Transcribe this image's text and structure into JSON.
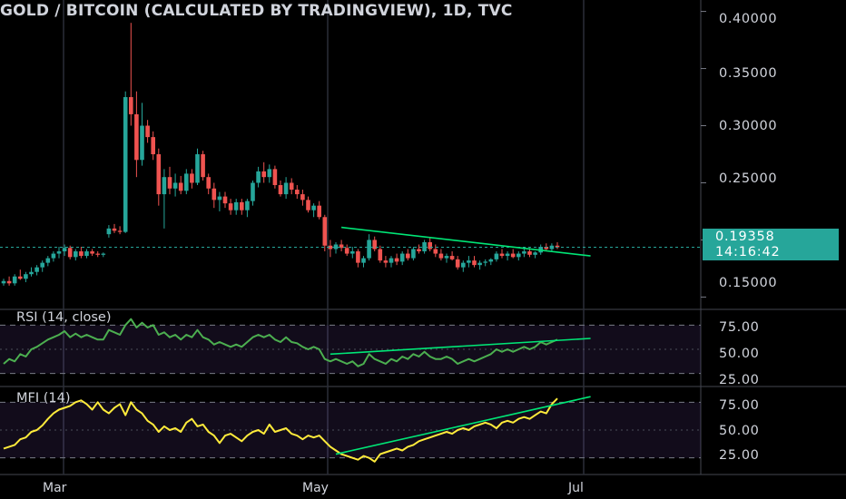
{
  "header": {
    "title": "GOLD / BITCOIN (CALCULATED BY TRADINGVIEW), 1D, TVC"
  },
  "colors": {
    "up": "#26a69a",
    "down": "#ef5350",
    "rsi": "#4caf50",
    "mfi": "#ffeb3b",
    "trend": "#00e676",
    "grid": "#2a2e39"
  },
  "price_pane": {
    "ticks": [
      "0.40000",
      "0.35000",
      "0.30000",
      "0.25000",
      "0.15000"
    ],
    "last_price": "0.19358",
    "countdown": "14:16:42"
  },
  "rsi_pane": {
    "label": "RSI (14, close)",
    "ticks": [
      "75.00",
      "50.00",
      "25.00"
    ]
  },
  "mfi_pane": {
    "label": "MFI (14)",
    "ticks": [
      "75.00",
      "50.00",
      "25.00"
    ]
  },
  "x_axis": {
    "labels": [
      "Mar",
      "May",
      "Jul"
    ]
  },
  "chart_data": [
    {
      "type": "candlestick",
      "series_name": "GOLD / BITCOIN",
      "ylim": [
        0.14,
        0.41
      ],
      "x_labels": [
        "Mar",
        "May",
        "Jul"
      ],
      "candles": [
        [
          0.162,
          0.166,
          0.16,
          0.164
        ],
        [
          0.164,
          0.168,
          0.16,
          0.162
        ],
        [
          0.162,
          0.17,
          0.16,
          0.168
        ],
        [
          0.168,
          0.174,
          0.165,
          0.166
        ],
        [
          0.166,
          0.172,
          0.163,
          0.17
        ],
        [
          0.17,
          0.176,
          0.168,
          0.172
        ],
        [
          0.172,
          0.178,
          0.169,
          0.176
        ],
        [
          0.176,
          0.182,
          0.172,
          0.18
        ],
        [
          0.18,
          0.186,
          0.177,
          0.184
        ],
        [
          0.184,
          0.19,
          0.181,
          0.188
        ],
        [
          0.188,
          0.194,
          0.184,
          0.19
        ],
        [
          0.19,
          0.196,
          0.186,
          0.193
        ],
        [
          0.193,
          0.195,
          0.183,
          0.185
        ],
        [
          0.185,
          0.192,
          0.182,
          0.19
        ],
        [
          0.19,
          0.194,
          0.184,
          0.186
        ],
        [
          0.186,
          0.192,
          0.184,
          0.19
        ],
        [
          0.19,
          0.192,
          0.186,
          0.188
        ],
        [
          0.188,
          0.19,
          0.185,
          0.187
        ],
        [
          0.187,
          0.189,
          0.185,
          0.188
        ],
        [
          0.205,
          0.213,
          0.202,
          0.21
        ],
        [
          0.21,
          0.214,
          0.206,
          0.208
        ],
        [
          0.208,
          0.212,
          0.205,
          0.207
        ],
        [
          0.207,
          0.33,
          0.206,
          0.325
        ],
        [
          0.325,
          0.39,
          0.3,
          0.31
        ],
        [
          0.31,
          0.33,
          0.255,
          0.27
        ],
        [
          0.27,
          0.32,
          0.265,
          0.3
        ],
        [
          0.3,
          0.305,
          0.285,
          0.29
        ],
        [
          0.29,
          0.295,
          0.27,
          0.275
        ],
        [
          0.275,
          0.28,
          0.23,
          0.24
        ],
        [
          0.24,
          0.262,
          0.21,
          0.255
        ],
        [
          0.255,
          0.264,
          0.24,
          0.245
        ],
        [
          0.245,
          0.258,
          0.238,
          0.25
        ],
        [
          0.25,
          0.256,
          0.24,
          0.243
        ],
        [
          0.243,
          0.262,
          0.24,
          0.258
        ],
        [
          0.258,
          0.262,
          0.245,
          0.25
        ],
        [
          0.25,
          0.28,
          0.248,
          0.275
        ],
        [
          0.275,
          0.278,
          0.252,
          0.255
        ],
        [
          0.255,
          0.258,
          0.24,
          0.245
        ],
        [
          0.245,
          0.25,
          0.228,
          0.235
        ],
        [
          0.235,
          0.242,
          0.225,
          0.238
        ],
        [
          0.238,
          0.242,
          0.228,
          0.232
        ],
        [
          0.232,
          0.236,
          0.222,
          0.226
        ],
        [
          0.226,
          0.236,
          0.222,
          0.233
        ],
        [
          0.233,
          0.236,
          0.222,
          0.226
        ],
        [
          0.226,
          0.236,
          0.22,
          0.234
        ],
        [
          0.234,
          0.252,
          0.23,
          0.25
        ],
        [
          0.25,
          0.264,
          0.246,
          0.26
        ],
        [
          0.26,
          0.268,
          0.25,
          0.255
        ],
        [
          0.255,
          0.266,
          0.25,
          0.262
        ],
        [
          0.262,
          0.265,
          0.245,
          0.248
        ],
        [
          0.248,
          0.252,
          0.238,
          0.24
        ],
        [
          0.24,
          0.255,
          0.236,
          0.25
        ],
        [
          0.25,
          0.254,
          0.24,
          0.244
        ],
        [
          0.244,
          0.248,
          0.236,
          0.24
        ],
        [
          0.24,
          0.244,
          0.23,
          0.235
        ],
        [
          0.235,
          0.238,
          0.224,
          0.226
        ],
        [
          0.226,
          0.232,
          0.22,
          0.23
        ],
        [
          0.23,
          0.234,
          0.218,
          0.22
        ],
        [
          0.22,
          0.222,
          0.19,
          0.195
        ],
        [
          0.195,
          0.2,
          0.185,
          0.192
        ],
        [
          0.192,
          0.198,
          0.188,
          0.196
        ],
        [
          0.196,
          0.2,
          0.19,
          0.193
        ],
        [
          0.193,
          0.196,
          0.186,
          0.188
        ],
        [
          0.188,
          0.194,
          0.184,
          0.19
        ],
        [
          0.19,
          0.192,
          0.176,
          0.18
        ],
        [
          0.18,
          0.186,
          0.176,
          0.184
        ],
        [
          0.184,
          0.205,
          0.182,
          0.2
        ],
        [
          0.2,
          0.203,
          0.19,
          0.192
        ],
        [
          0.192,
          0.195,
          0.18,
          0.182
        ],
        [
          0.182,
          0.186,
          0.176,
          0.18
        ],
        [
          0.18,
          0.186,
          0.176,
          0.184
        ],
        [
          0.184,
          0.188,
          0.178,
          0.181
        ],
        [
          0.181,
          0.19,
          0.178,
          0.188
        ],
        [
          0.188,
          0.192,
          0.182,
          0.184
        ],
        [
          0.184,
          0.194,
          0.182,
          0.192
        ],
        [
          0.192,
          0.196,
          0.188,
          0.19
        ],
        [
          0.19,
          0.2,
          0.188,
          0.198
        ],
        [
          0.198,
          0.202,
          0.19,
          0.192
        ],
        [
          0.192,
          0.196,
          0.185,
          0.188
        ],
        [
          0.188,
          0.192,
          0.182,
          0.184
        ],
        [
          0.184,
          0.188,
          0.18,
          0.186
        ],
        [
          0.186,
          0.19,
          0.182,
          0.183
        ],
        [
          0.183,
          0.186,
          0.174,
          0.176
        ],
        [
          0.176,
          0.182,
          0.172,
          0.18
        ],
        [
          0.18,
          0.186,
          0.176,
          0.182
        ],
        [
          0.182,
          0.186,
          0.176,
          0.178
        ],
        [
          0.178,
          0.182,
          0.174,
          0.18
        ],
        [
          0.18,
          0.183,
          0.177,
          0.181
        ],
        [
          0.181,
          0.184,
          0.178,
          0.183
        ],
        [
          0.183,
          0.19,
          0.181,
          0.188
        ],
        [
          0.188,
          0.192,
          0.184,
          0.186
        ],
        [
          0.186,
          0.19,
          0.182,
          0.188
        ],
        [
          0.188,
          0.192,
          0.184,
          0.185
        ],
        [
          0.185,
          0.19,
          0.182,
          0.188
        ],
        [
          0.188,
          0.192,
          0.185,
          0.19
        ],
        [
          0.19,
          0.193,
          0.185,
          0.187
        ],
        [
          0.187,
          0.19,
          0.184,
          0.189
        ],
        [
          0.189,
          0.196,
          0.187,
          0.194
        ],
        [
          0.194,
          0.197,
          0.19,
          0.192
        ],
        [
          0.192,
          0.197,
          0.19,
          0.195
        ],
        [
          0.195,
          0.198,
          0.192,
          0.1936
        ]
      ],
      "trendline": {
        "from": [
          61,
          0.211
        ],
        "to": [
          106,
          0.186
        ]
      }
    },
    {
      "type": "line",
      "name": "RSI (14, close)",
      "ylim": [
        20,
        80
      ],
      "bands": [
        30,
        70
      ],
      "values": [
        38,
        42,
        40,
        46,
        44,
        50,
        52,
        55,
        58,
        60,
        62,
        65,
        60,
        63,
        60,
        62,
        60,
        58,
        58,
        66,
        64,
        62,
        70,
        75,
        68,
        72,
        68,
        70,
        62,
        64,
        60,
        62,
        58,
        62,
        60,
        66,
        60,
        58,
        54,
        56,
        54,
        52,
        54,
        52,
        56,
        60,
        62,
        60,
        62,
        58,
        56,
        60,
        56,
        55,
        52,
        50,
        52,
        50,
        42,
        40,
        42,
        40,
        38,
        40,
        36,
        38,
        46,
        42,
        40,
        38,
        42,
        40,
        44,
        42,
        46,
        44,
        48,
        44,
        42,
        42,
        44,
        42,
        38,
        40,
        42,
        40,
        42,
        44,
        46,
        50,
        48,
        50,
        48,
        50,
        52,
        50,
        52,
        56,
        54,
        56,
        58
      ],
      "trendline": {
        "from": [
          59,
          46
        ],
        "to": [
          106,
          59
        ]
      }
    },
    {
      "type": "line",
      "name": "MFI (14)",
      "ylim": [
        5,
        95
      ],
      "bands": [
        20,
        80
      ],
      "values": [
        30,
        32,
        34,
        40,
        42,
        48,
        50,
        55,
        62,
        68,
        72,
        74,
        76,
        80,
        82,
        78,
        72,
        80,
        72,
        68,
        74,
        78,
        66,
        80,
        72,
        68,
        60,
        56,
        48,
        54,
        50,
        52,
        48,
        58,
        62,
        54,
        56,
        48,
        44,
        36,
        44,
        46,
        42,
        38,
        44,
        48,
        50,
        46,
        56,
        48,
        50,
        52,
        46,
        44,
        40,
        44,
        42,
        44,
        38,
        32,
        28,
        24,
        22,
        20,
        18,
        22,
        20,
        16,
        24,
        26,
        28,
        30,
        28,
        32,
        34,
        38,
        40,
        42,
        44,
        46,
        48,
        46,
        50,
        52,
        50,
        54,
        56,
        58,
        56,
        52,
        58,
        60,
        58,
        62,
        64,
        62,
        66,
        70,
        68,
        78,
        84
      ],
      "trendline": {
        "from": [
          60,
          24
        ],
        "to": [
          106,
          86
        ]
      }
    }
  ]
}
